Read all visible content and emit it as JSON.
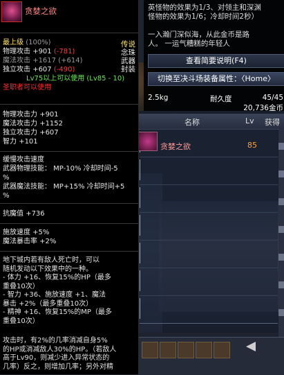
{
  "item": {
    "name": "贪婪之欲",
    "rarity": "最上级",
    "rarity_pct": "(100%)",
    "compare_stats": [
      {
        "label": "物理攻击",
        "value": "+901",
        "diff": "(-781)",
        "diff_type": "neg"
      },
      {
        "label": "魔法攻击",
        "value": "+1617",
        "diff": "(+614)",
        "diff_type": "pos"
      },
      {
        "label": "独立攻击",
        "value": "+607",
        "diff": "(-490)",
        "diff_type": "neg"
      }
    ],
    "category": [
      "传说",
      "念珠",
      "武器",
      "封装"
    ],
    "level_req": "Lv75以上可以使用 (Lv85 - 10)",
    "class_req": "圣职者可以使用",
    "stats": [
      {
        "label": "物理攻击力",
        "value": "+901"
      },
      {
        "label": "魔法攻击力",
        "value": "+1152"
      },
      {
        "label": "独立攻击力",
        "value": "+607"
      },
      {
        "label": "智力",
        "value": "+101"
      }
    ],
    "effects": [
      "缓慢攻击速度",
      "武器物理技能： MP-10% 冷却时间-5",
      "%",
      "武器魔法技能： MP+15% 冷却时间+5",
      "%"
    ],
    "resist": {
      "label": "抗魔值",
      "value": "+736"
    },
    "speed_lines": [
      "施放速度 +5%",
      "魔法暴击率 +2%"
    ],
    "desc_paragraph_1": [
      "    地下城内若有敌人死亡时，可以",
      "随机发动以下效果中的一种。",
      "  - 体力 +16、恢复15%的HP（最多",
      "重叠10次）",
      "  - 智力 +36、施放速度 +1、魔法",
      "暴击 +2%（最多重叠10次）",
      "  - 精神 +16、恢复15%的MP（最多",
      "重叠10次）"
    ],
    "desc_paragraph_2": [
      "    攻击时，有2%的几率消减自身5%",
      "的HP或消减敌人30%的HP。（若敌人",
      "高于Lv90，则减少进入异常状态的",
      "几率）反之，则增加几率；另外对精"
    ]
  },
  "tooltip2": {
    "lines": [
      "英怪物的效果为1/3、对领主和深渊",
      "怪物的效果为1/6；冷却时间2秒）",
      "",
      "    一入瀚门深似海，从此金币是路",
      "人。 一运气糟糕的年轻人"
    ],
    "btn_desc": "查看简要说明(F4)",
    "btn_switch": "切换至决斗场装备属性：〈Home〉",
    "weight": "2.5kg",
    "durability_label": "耐久度",
    "durability": "45/45",
    "gold": "20,736金币"
  },
  "list": {
    "col_name": "名称",
    "col_lv": "Lv",
    "col_get": "获得",
    "row_name": "贪婪之欲",
    "row_lv": "85"
  }
}
